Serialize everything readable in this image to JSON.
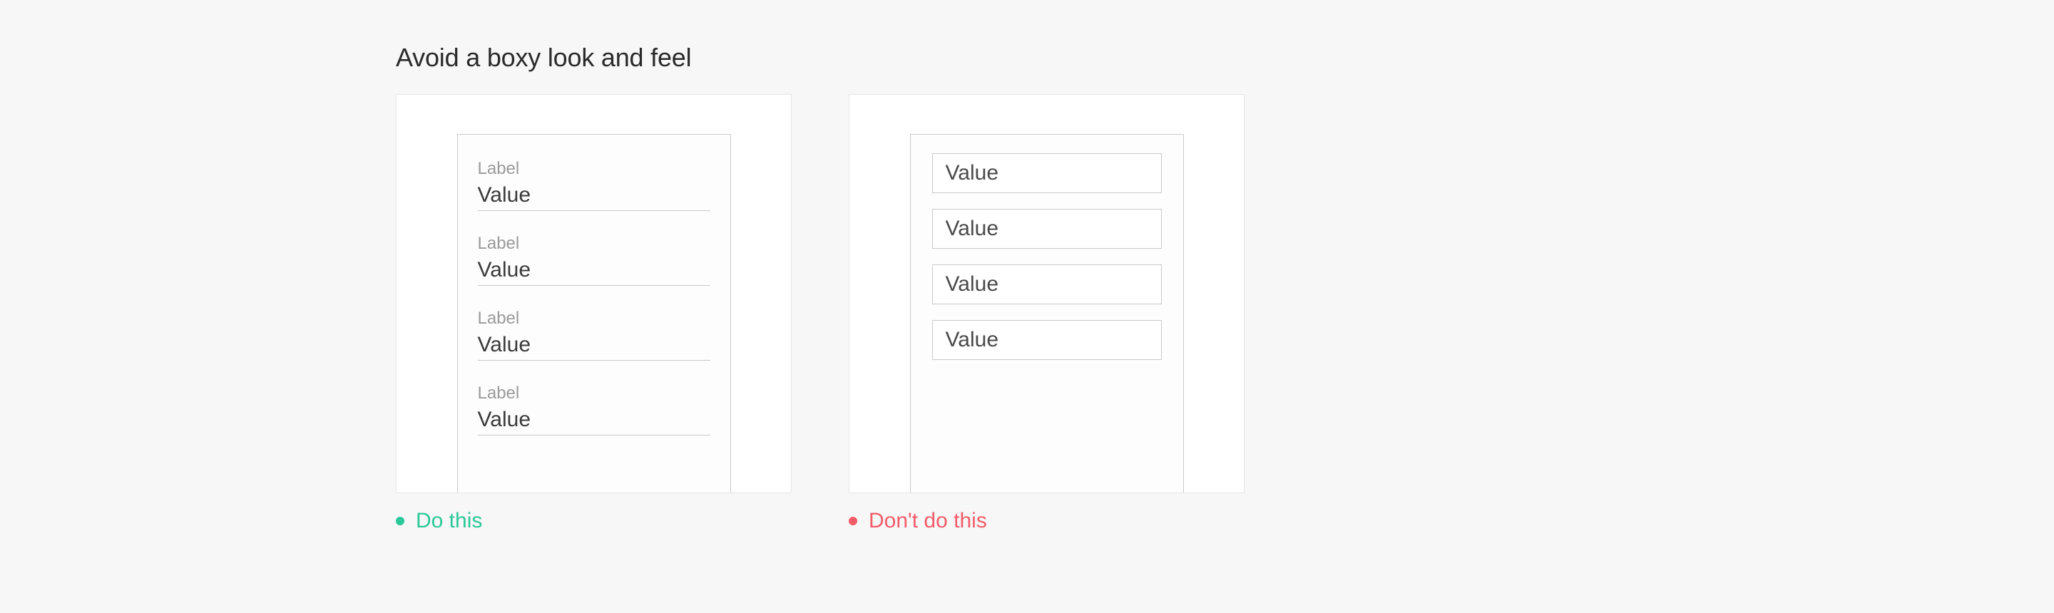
{
  "title": "Avoid a boxy look and feel",
  "do": {
    "caption": "Do this",
    "fields": [
      {
        "label": "Label",
        "value": "Value"
      },
      {
        "label": "Label",
        "value": "Value"
      },
      {
        "label": "Label",
        "value": "Value"
      },
      {
        "label": "Label",
        "value": "Value"
      }
    ]
  },
  "dont": {
    "caption": "Don't do this",
    "fields": [
      {
        "value": "Value"
      },
      {
        "value": "Value"
      },
      {
        "value": "Value"
      },
      {
        "value": "Value"
      }
    ]
  }
}
